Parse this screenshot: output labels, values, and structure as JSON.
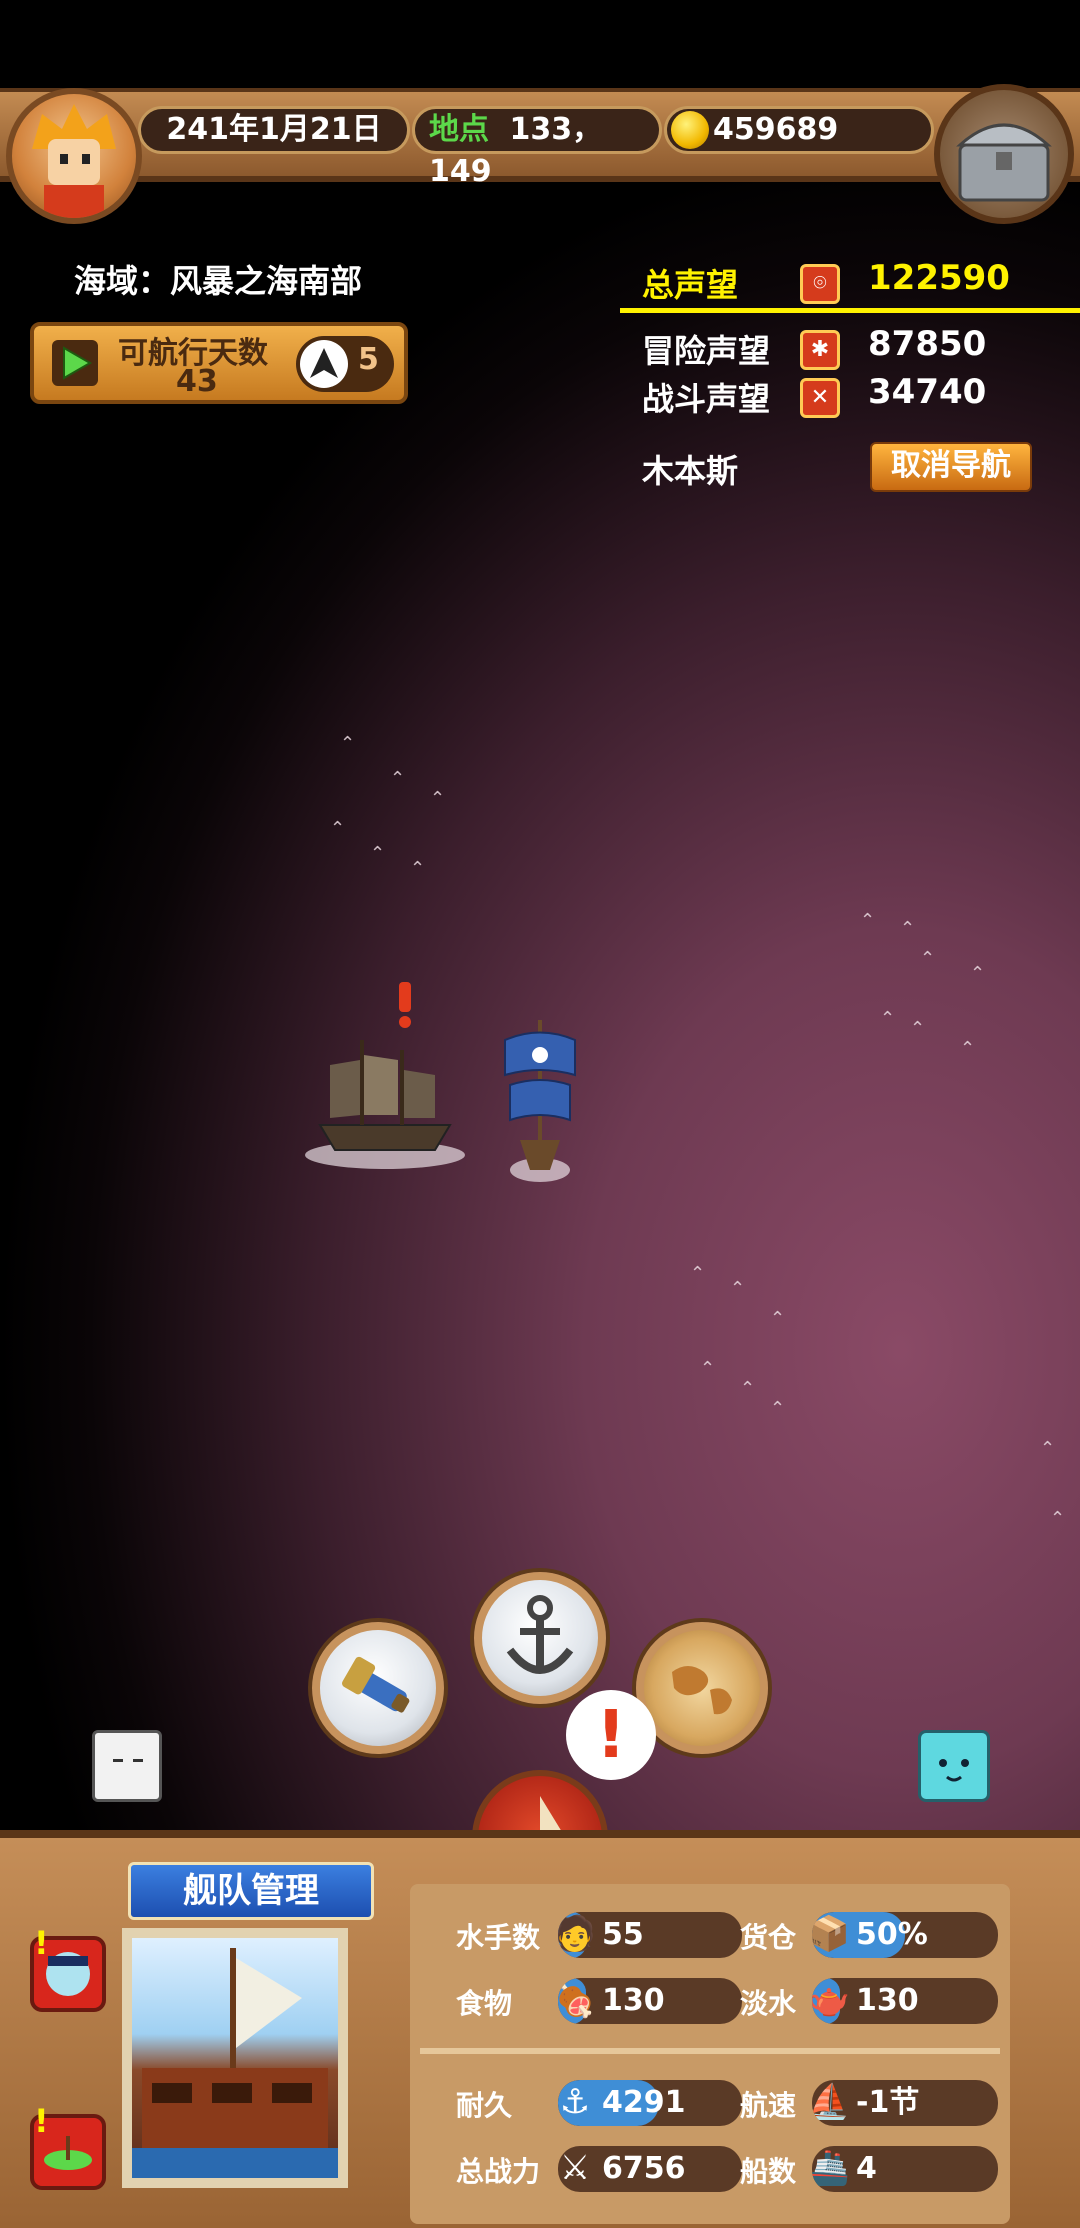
{
  "top_bar": {
    "date": "241年1月21日",
    "location_label": "地点",
    "location_value": "133，149",
    "gold": "459689"
  },
  "sea_area": {
    "label": "海域：风暴之海南部"
  },
  "sail_days": {
    "label": "可航行天数",
    "value": "43",
    "boost_count": "5"
  },
  "reputation": {
    "total_label": "总声望",
    "total_value": "122590",
    "adventure_label": "冒险声望",
    "adventure_value": "87850",
    "battle_label": "战斗声望",
    "battle_value": "34740"
  },
  "navigation": {
    "destination": "木本斯",
    "cancel_label": "取消导航"
  },
  "actions": {
    "telescope_icon": "telescope-icon",
    "anchor_icon": "anchor-icon",
    "map_icon": "world-map-icon",
    "alert": "!"
  },
  "fleet": {
    "title": "舰队管理",
    "stats": {
      "sailors_label": "水手数",
      "sailors_value": "55",
      "sailors_fill": 0.15,
      "cargo_label": "货仓",
      "cargo_value": "50%",
      "cargo_fill": 0.5,
      "food_label": "食物",
      "food_value": "130",
      "food_fill": 0.15,
      "water_label": "淡水",
      "water_value": "130",
      "water_fill": 0.15,
      "durability_label": "耐久",
      "durability_value": "4291",
      "durability_fill": 0.55,
      "speed_label": "航速",
      "speed_value": "-1节",
      "power_label": "总战力",
      "power_value": "6756",
      "ships_label": "船数",
      "ships_value": "4"
    }
  },
  "colors": {
    "accent_yellow": "#fff200",
    "bar_blue": "#3f8ed6",
    "wood": "#c58e58"
  }
}
